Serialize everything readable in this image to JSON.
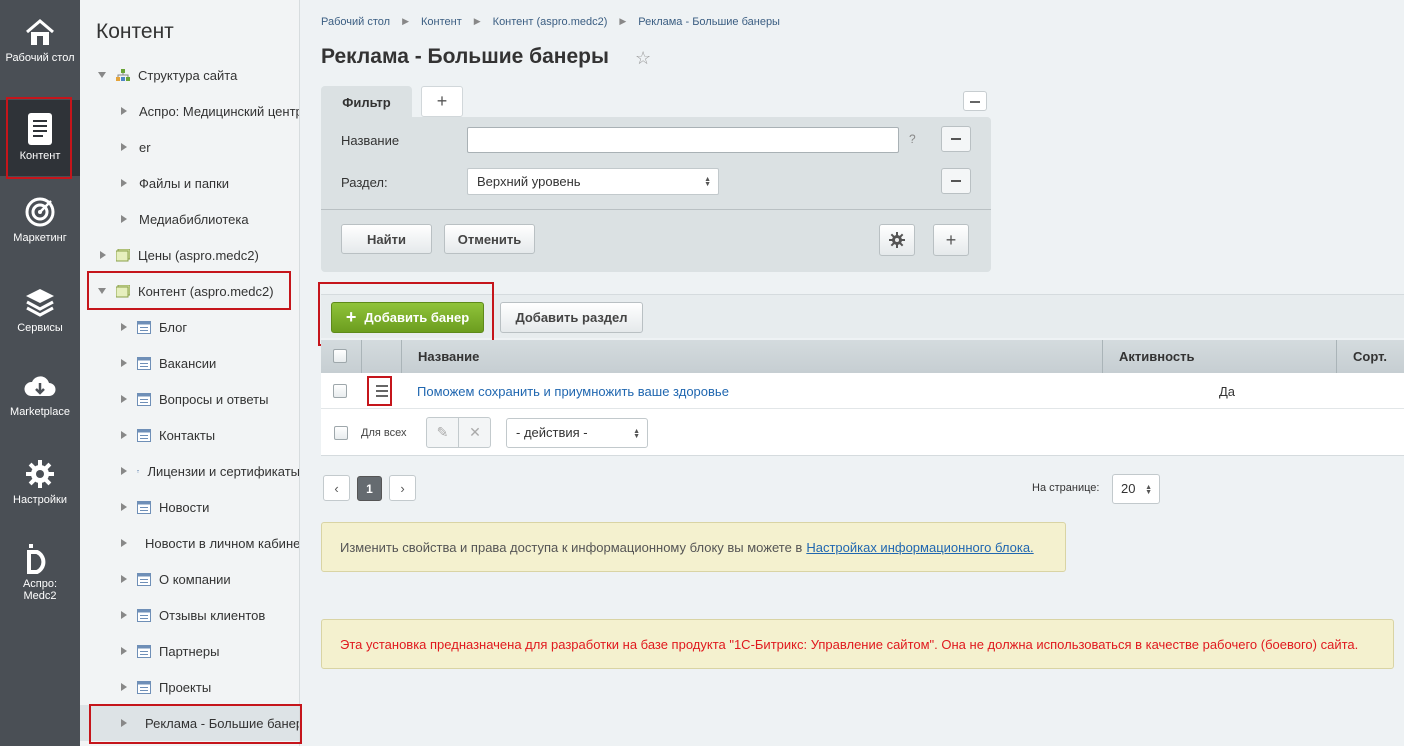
{
  "rail": {
    "items": [
      {
        "label": "Рабочий стол",
        "icon": "home-icon"
      },
      {
        "label": "Контент",
        "icon": "document-icon"
      },
      {
        "label": "Маркетинг",
        "icon": "target-icon"
      },
      {
        "label": "Сервисы",
        "icon": "layers-icon"
      },
      {
        "label": "Marketplace",
        "icon": "cloud-download-icon"
      },
      {
        "label": "Настройки",
        "icon": "gear-icon"
      },
      {
        "label": "Аспро: Medc2",
        "icon": "aspro-logo-icon"
      }
    ]
  },
  "tree": {
    "title": "Контент",
    "items": [
      {
        "label": "Структура сайта"
      },
      {
        "label": "Аспро: Медицинский центр"
      },
      {
        "label": "er"
      },
      {
        "label": "Файлы и папки"
      },
      {
        "label": "Медиабиблиотека"
      },
      {
        "label": "Цены (aspro.medc2)"
      },
      {
        "label": "Контент (aspro.medc2)"
      },
      {
        "label": "Блог"
      },
      {
        "label": "Вакансии"
      },
      {
        "label": "Вопросы и ответы"
      },
      {
        "label": "Контакты"
      },
      {
        "label": "Лицензии и сертификаты"
      },
      {
        "label": "Новости"
      },
      {
        "label": "Новости в личном кабинете"
      },
      {
        "label": "О компании"
      },
      {
        "label": "Отзывы клиентов"
      },
      {
        "label": "Партнеры"
      },
      {
        "label": "Проекты"
      },
      {
        "label": "Реклама - Большие банеры"
      }
    ]
  },
  "breadcrumb": [
    "Рабочий стол",
    "Контент",
    "Контент (aspro.medc2)",
    "Реклама - Большие банеры"
  ],
  "page": {
    "title": "Реклама - Большие банеры"
  },
  "filter": {
    "tab_label": "Фильтр",
    "add_tab": "+",
    "name_label": "Название",
    "name_value": "",
    "help": "?",
    "section_label": "Раздел:",
    "section_value": "Верхний уровень",
    "find_button": "Найти",
    "cancel_button": "Отменить",
    "add_field": "+"
  },
  "toolbar": {
    "add_banner": "Добавить банер",
    "add_section": "Добавить раздел"
  },
  "grid": {
    "columns": [
      "Название",
      "Активность",
      "Сорт."
    ],
    "rows": [
      {
        "name": "Поможем сохранить и приумножить ваше здоровье",
        "active": "Да"
      }
    ],
    "for_all_label": "Для всех",
    "actions_value": "- действия -"
  },
  "pager": {
    "prev": "‹",
    "current": "1",
    "next": "›",
    "per_page_label": "На странице:",
    "per_page_value": "20"
  },
  "notes": {
    "info_text": "Изменить свойства и права доступа к информационному блоку вы можете в",
    "info_link": "Настройках информационного блока.",
    "warning_text": "Эта установка предназначена для разработки на базе продукта \"1С-Битрикс: Управление сайтом\". Она не должна использоваться в качестве рабочего (боевого) сайта."
  },
  "colors": {
    "rail_bg": "#4a4f55",
    "accent_green": "#7cb029",
    "link_blue": "#2067b0",
    "highlight_red": "#c5151b",
    "warning_red": "#e0191e"
  }
}
